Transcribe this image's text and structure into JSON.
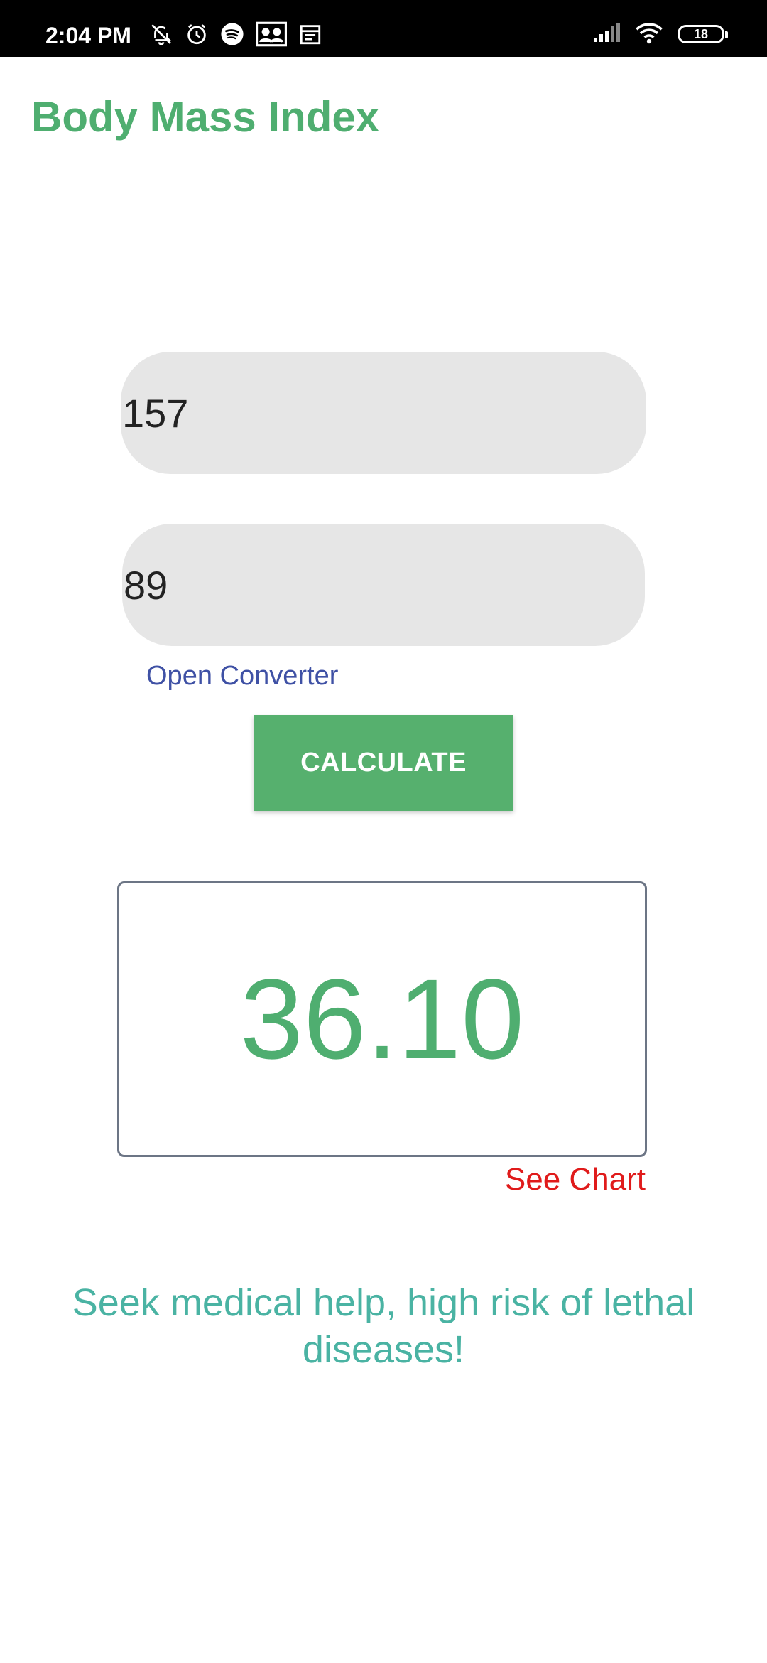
{
  "status_bar": {
    "time": "2:04 PM",
    "battery": "18",
    "left_icons": [
      "bell-off-icon",
      "alarm-icon",
      "spotify-icon",
      "contacts-icon",
      "calendar-icon"
    ],
    "right_icons": [
      "signal-icon",
      "wifi-icon",
      "battery-icon"
    ]
  },
  "app": {
    "title": "Body Mass Index",
    "accent_color": "#4fae70"
  },
  "form": {
    "height_value": "157",
    "weight_value": "89",
    "converter_link": "Open Converter",
    "calculate_label": "CALCULATE"
  },
  "result": {
    "bmi": "36.10",
    "see_chart_label": "See Chart",
    "advice": "Seek medical help, high risk of lethal diseases!"
  }
}
